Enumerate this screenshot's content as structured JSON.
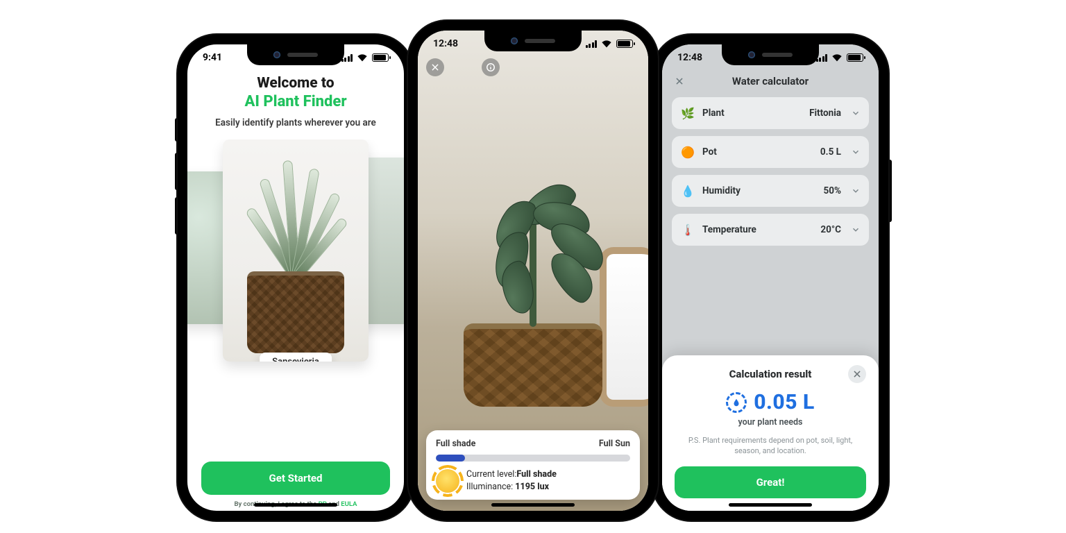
{
  "phone1": {
    "status_time": "9:41",
    "title_line1": "Welcome to",
    "title_line2": "AI Plant Finder",
    "subtitle": "Easily identify plants wherever you are",
    "featured_plant": "Sansevieria",
    "cta": "Get Started",
    "legal_prefix": "By continuing, I agree to the ",
    "legal_pp": "PP",
    "legal_and": " and ",
    "legal_eula": "EULA"
  },
  "phone2": {
    "status_time": "12:48",
    "slider_min_label": "Full shade",
    "slider_max_label": "Full Sun",
    "slider_fill_percent": 15,
    "current_level_label": "Current level:",
    "current_level_value": "Full shade",
    "illuminance_label": "Illuminance: ",
    "illuminance_value": "1195 lux"
  },
  "phone3": {
    "status_time": "12:48",
    "header_title": "Water calculator",
    "rows": [
      {
        "icon": "🌿",
        "label": "Plant",
        "value": "Fittonia"
      },
      {
        "icon": "🟠",
        "label": "Pot",
        "value": "0.5 L"
      },
      {
        "icon": "💧",
        "label": "Humidity",
        "value": "50%"
      },
      {
        "icon": "🌡️",
        "label": "Temperature",
        "value": "20°C"
      }
    ],
    "result_title": "Calculation result",
    "result_value": "0.05 L",
    "result_sub": "your plant needs",
    "ps": "P.S. Plant requirements depend on pot, soil, light, season, and location.",
    "cta": "Great!"
  },
  "colors": {
    "primary_green": "#1FC15D",
    "result_blue": "#1f6fe0"
  }
}
